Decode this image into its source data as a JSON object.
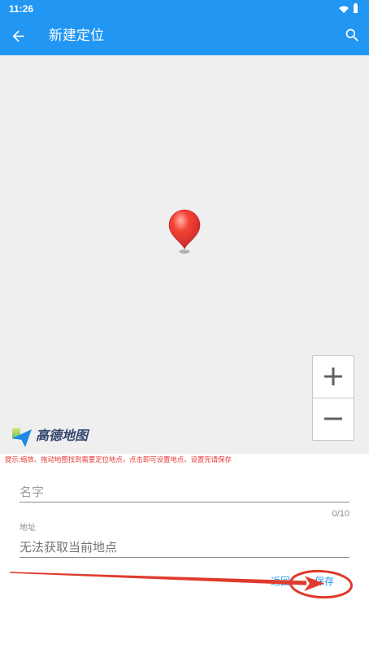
{
  "status_bar": {
    "time": "11:26",
    "wifi_icon": "wifi-icon",
    "battery_icon": "battery-icon"
  },
  "app_bar": {
    "back_icon": "arrow-back-icon",
    "title": "新建定位",
    "search_icon": "search-icon"
  },
  "map": {
    "pin_icon": "map-pin-icon",
    "zoom_in_icon": "plus-icon",
    "zoom_out_icon": "minus-icon",
    "logo_icon": "amap-logo-icon",
    "logo_text": "高德地图"
  },
  "hint": "提示:缩放、拖动地图找到需要定位地点，点击即可设置地点，设置完请保存",
  "form": {
    "name_field": {
      "placeholder": "名字",
      "counter": "0/10"
    },
    "address_field": {
      "label": "地址",
      "value": "无法获取当前地点"
    }
  },
  "actions": {
    "back_label": "返回",
    "save_label": "保存"
  },
  "colors": {
    "primary": "#2196F3",
    "hint_text": "#E53935",
    "annotation": "#E03A2C",
    "map_background": "#EFEFEF"
  }
}
